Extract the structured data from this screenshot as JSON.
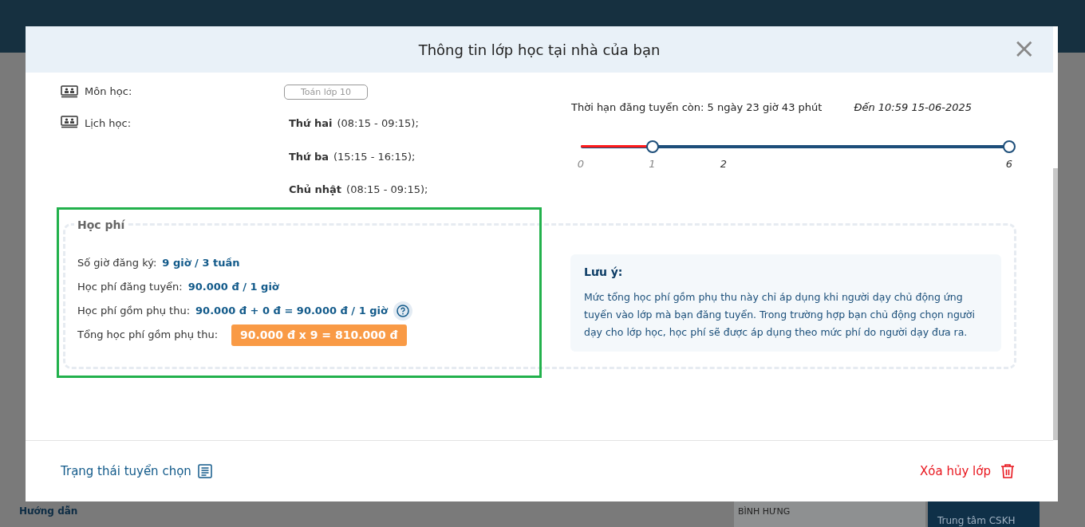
{
  "background": {
    "help_link": "Hướng dẫn",
    "map_label": "BÌNH HƯNG",
    "support_subtitle": "Trung tâm CSKH"
  },
  "dialog": {
    "title": "Thông tin lớp học tại nhà của bạn",
    "close": "×",
    "subject": {
      "label": "Môn học:",
      "value": "Toán lớp 10"
    },
    "schedule": {
      "label": "Lịch học:",
      "items": [
        {
          "day": "Thứ hai",
          "time": "(08:15 - 09:15);"
        },
        {
          "day": "Thứ ba",
          "time": "(15:15 - 16:15);"
        },
        {
          "day": "Chủ nhật",
          "time": "(08:15 - 09:15);"
        }
      ]
    },
    "deadline": {
      "remaining": "Thời hạn đăng tuyển còn: 5 ngày 23 giờ 43 phút",
      "until": "Đến 10:59 15-06-2025",
      "level": 0.1667,
      "ticks": [
        "0",
        "1",
        "2",
        "6"
      ]
    },
    "fee": {
      "title": "Học phí",
      "rows": [
        {
          "label": "Số giờ đăng ký:",
          "value": "9 giờ / 3 tuần",
          "kind": "text"
        },
        {
          "label": "Học phí đăng tuyển:",
          "value": "90.000 đ / 1 giờ",
          "kind": "text"
        },
        {
          "label": "Học phí gồm phụ thu:",
          "value": "90.000 đ + 0 đ = 90.000 đ / 1 giờ",
          "kind": "help"
        },
        {
          "label": "Tổng học phí gồm phụ thu:",
          "value": "90.000 đ x 9 = 810.000 đ",
          "kind": "total"
        }
      ],
      "note_title": "Lưu ý:",
      "note": "Mức tổng học phí gồm phụ thu này chỉ áp dụng khi người dạy chủ động ứng tuyển vào lớp mà bạn đăng tuyển. Trong trường hợp bạn chủ động chọn người dạy cho lớp học, học phí sẽ được áp dụng theo mức phí do người dạy đưa ra."
    },
    "footer": {
      "status_link": "Trạng thái tuyển chọn",
      "delete": "Xóa hủy lớp"
    }
  }
}
